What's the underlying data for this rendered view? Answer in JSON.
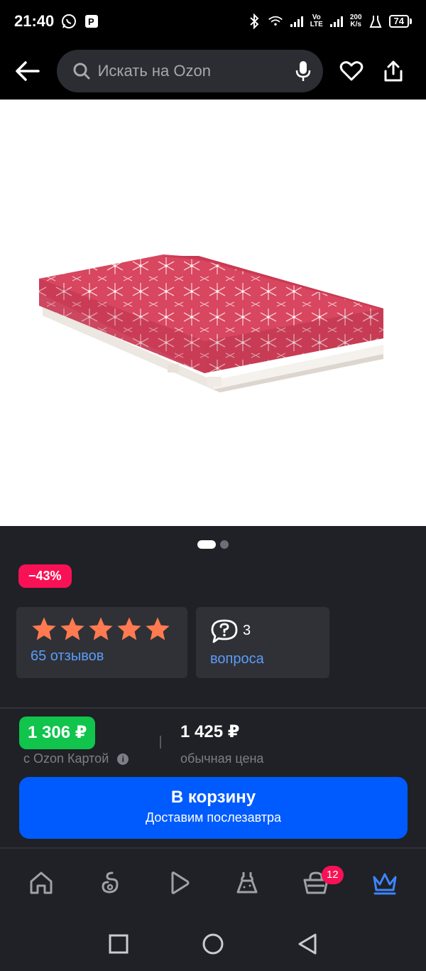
{
  "status_bar": {
    "time": "21:40",
    "net_speed_value": "200",
    "net_speed_unit": "K/s",
    "battery": "74",
    "volte_top": "Vo",
    "volte_bottom": "LTE"
  },
  "top_bar": {
    "search_placeholder": "Искать на Ozon"
  },
  "product": {
    "discount": "−43%",
    "rating_stars": 5,
    "reviews_label": "65 отзывов",
    "questions_count": "3",
    "questions_label": "вопроса",
    "gallery_total": 2,
    "gallery_active": 1
  },
  "pricing": {
    "card_price": "1 306 ₽",
    "card_price_label": "с Ozon Картой",
    "regular_price": "1 425 ₽",
    "regular_price_label": "обычная цена"
  },
  "cart_button": {
    "title": "В корзину",
    "subtitle": "Доставим послезавтра"
  },
  "bottom_nav": {
    "items": [
      {
        "name": "home",
        "icon": "home-icon"
      },
      {
        "name": "fresh",
        "icon": "fresh-icon"
      },
      {
        "name": "video",
        "icon": "play-icon"
      },
      {
        "name": "fashion",
        "icon": "dress-icon"
      },
      {
        "name": "cart",
        "icon": "basket-icon",
        "badge": "12"
      },
      {
        "name": "premium",
        "icon": "crown-icon",
        "active": true
      }
    ]
  },
  "colors": {
    "background": "#1f2126",
    "accent_blue": "#005bff",
    "link_blue": "#5b9cf8",
    "discount_pink": "#f91155",
    "card_price_green": "#10c44c",
    "star_orange": "#ff7a50"
  }
}
